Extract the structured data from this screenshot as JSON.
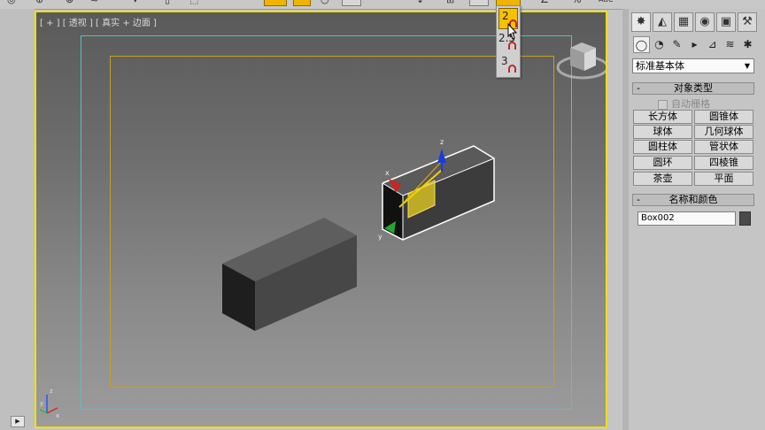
{
  "viewport": {
    "label": "[ + ] [ 透视 ] [ 真实 + 边面 ]"
  },
  "flyout": {
    "items": [
      {
        "label": "2",
        "highlighted": true
      },
      {
        "label": "2.5",
        "highlighted": false
      },
      {
        "label": "3",
        "highlighted": false
      }
    ]
  },
  "gizmo": {
    "x_label": "x",
    "y_label": "y",
    "z_label": "z"
  },
  "axis_tripod": {
    "x_label": "x",
    "y_label": "y",
    "z_label": "z"
  },
  "panel": {
    "category": "标准基本体",
    "object_type_title": "对象类型",
    "autogrid_label": "自动栅格",
    "buttons": [
      "长方体",
      "圆锥体",
      "球体",
      "几何球体",
      "圆柱体",
      "管状体",
      "圆环",
      "四棱锥",
      "茶壶",
      "平面"
    ],
    "name_color_title": "名称和颜色",
    "object_name": "Box002",
    "object_color": "#4a4a4a"
  },
  "colors": {
    "viewport_border": "#f0e000",
    "safe_frame_outer": "#4fc4c4",
    "safe_frame_inner": "#c9a020",
    "highlight": "#f5c200"
  }
}
